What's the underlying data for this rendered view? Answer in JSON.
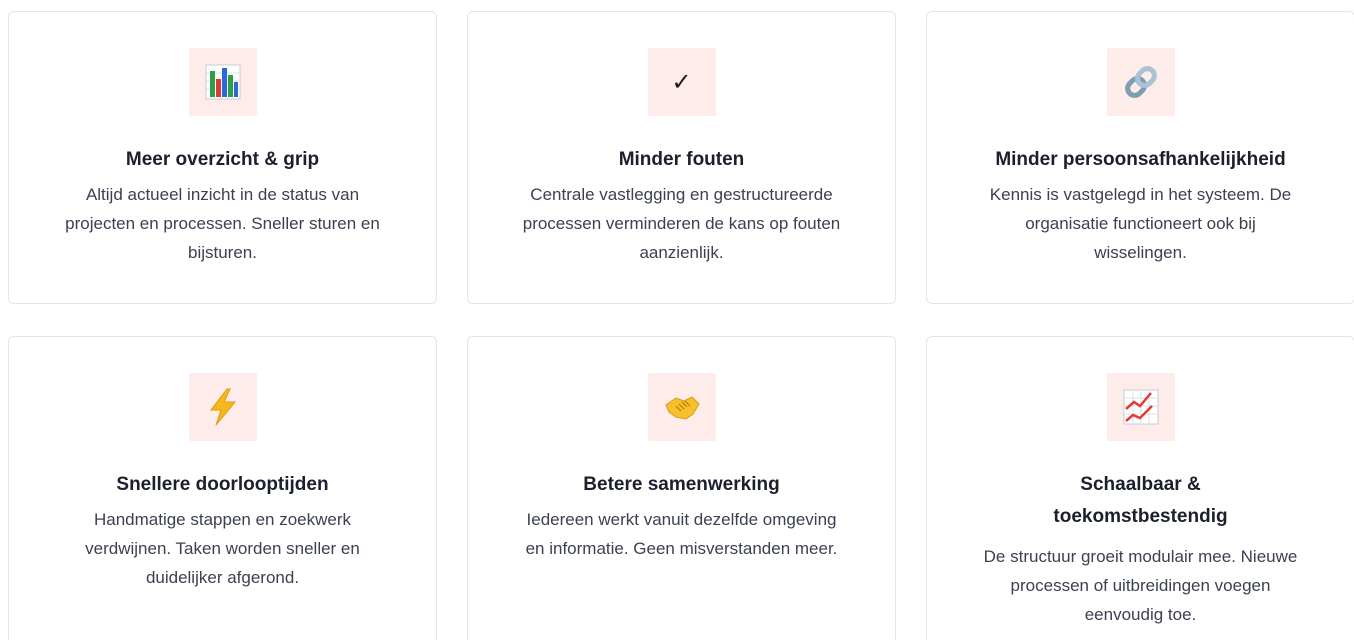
{
  "cards": [
    {
      "icon": "bar-chart-icon",
      "title": "Meer overzicht & grip",
      "description": "Altijd actueel inzicht in de status van projecten en processen. Sneller sturen en bijsturen."
    },
    {
      "icon": "check-icon",
      "icon_glyph": "✓",
      "title": "Minder fouten",
      "description": "Centrale vastlegging en gestructureerde processen verminderen de kans op fouten aanzienlijk."
    },
    {
      "icon": "link-icon",
      "title": "Minder persoonsafhankelijkheid",
      "description": "Kennis is vastgelegd in het systeem. De organisatie functioneert ook bij wisselingen."
    },
    {
      "icon": "lightning-icon",
      "title": "Snellere doorlooptijden",
      "description": "Handmatige stappen en zoekwerk verdwijnen. Taken worden sneller en duidelijker afgerond."
    },
    {
      "icon": "handshake-icon",
      "title": "Betere samenwerking",
      "description": "Iedereen werkt vanuit dezelfde omgeving en informatie. Geen misverstanden meer."
    },
    {
      "icon": "trending-up-chart-icon",
      "title": "Schaalbaar & toekomstbestendig",
      "description": "De structuur groeit modulair mee. Nieuwe processen of uitbreidingen voegen eenvoudig toe."
    }
  ],
  "colors": {
    "icon_background": "#fdecea",
    "card_border": "#e3e5ea",
    "title_text": "#1c1f2e",
    "body_text": "#3c4152"
  }
}
